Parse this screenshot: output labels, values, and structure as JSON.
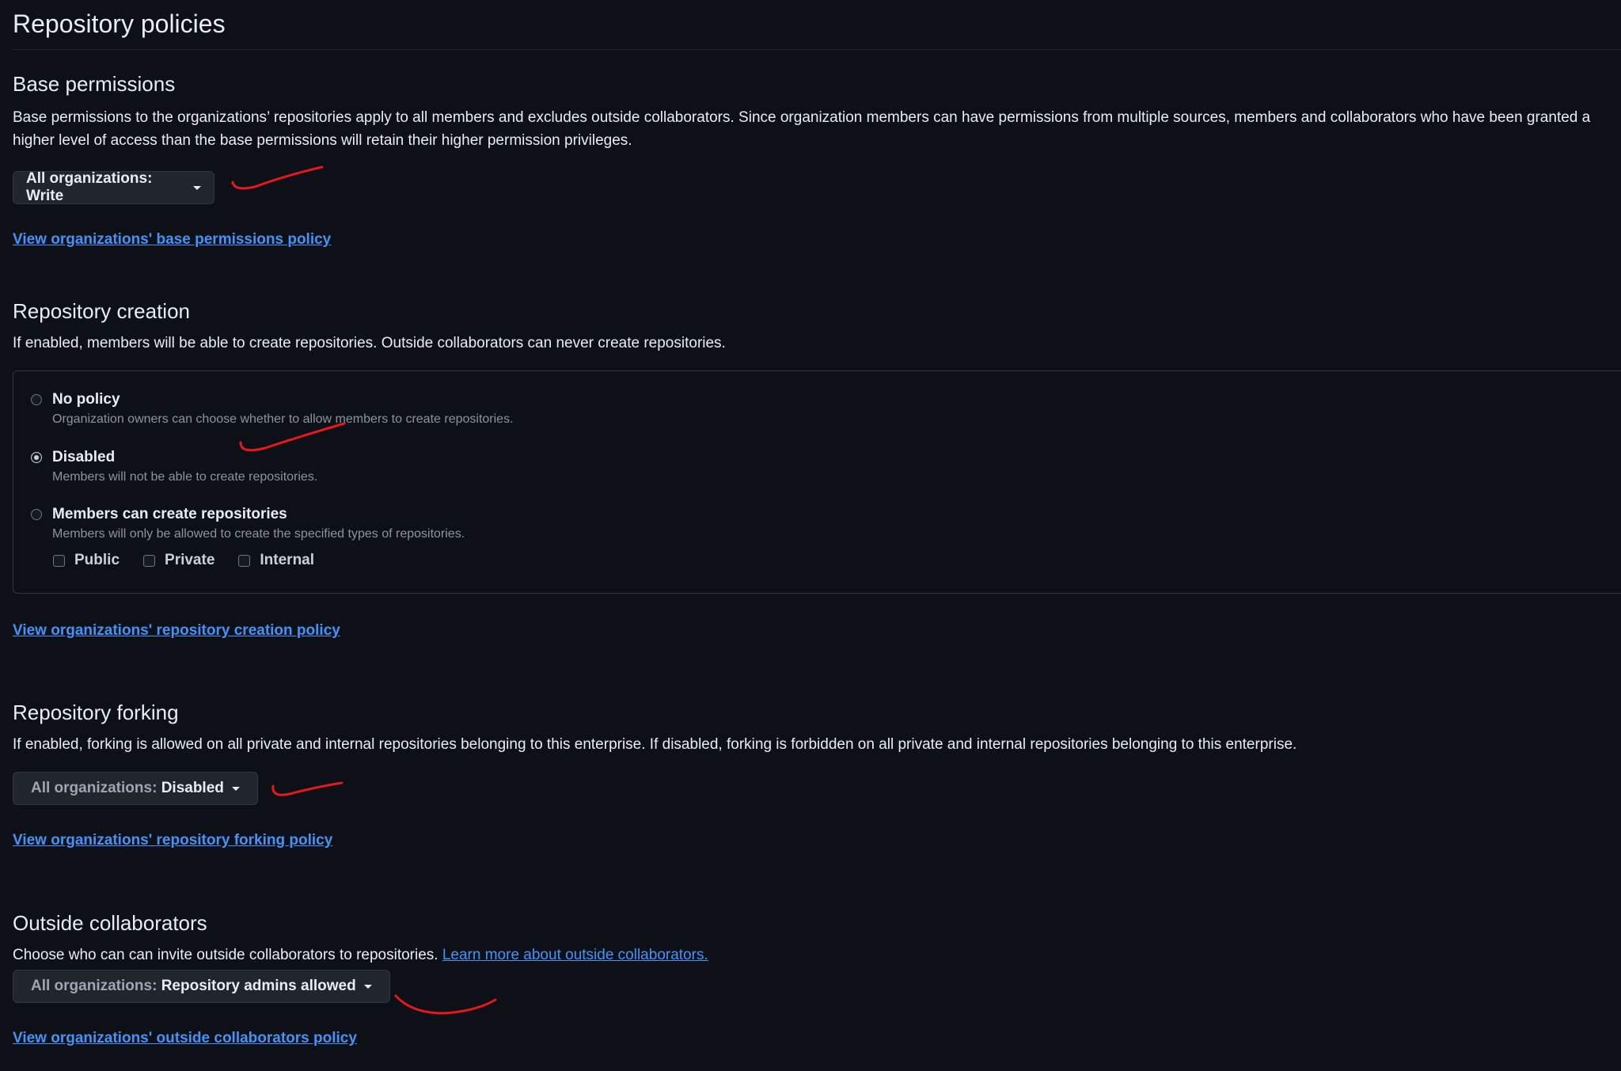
{
  "page": {
    "title": "Repository policies"
  },
  "base_permissions": {
    "heading": "Base permissions",
    "description": "Base permissions to the organizations’ repositories apply to all members and excludes outside collaborators. Since organization members can have permissions from multiple sources, members and collaborators who have been granted a higher level of access than the base permissions will retain their higher permission privileges.",
    "dropdown_label": "All organizations: Write",
    "policy_link": "View organizations' base permissions policy"
  },
  "repository_creation": {
    "heading": "Repository creation",
    "description": "If enabled, members will be able to create repositories. Outside collaborators can never create repositories.",
    "options": [
      {
        "label": "No policy",
        "help": "Organization owners can choose whether to allow members to create repositories.",
        "checked": false
      },
      {
        "label": "Disabled",
        "help": "Members will not be able to create repositories.",
        "checked": true
      },
      {
        "label": "Members can create repositories",
        "help": "Members will only be allowed to create the specified types of repositories.",
        "checked": false
      }
    ],
    "repo_types": [
      "Public",
      "Private",
      "Internal"
    ],
    "policy_link": "View organizations' repository creation policy"
  },
  "repository_forking": {
    "heading": "Repository forking",
    "description": "If enabled, forking is allowed on all private and internal repositories belonging to this enterprise. If disabled, forking is forbidden on all private and internal repositories belonging to this enterprise.",
    "dropdown_prefix": "All organizations:",
    "dropdown_value": "Disabled",
    "policy_link": "View organizations' repository forking policy"
  },
  "outside_collaborators": {
    "heading": "Outside collaborators",
    "description": "Choose who can can invite outside collaborators to repositories.",
    "learn_more": "Learn more about outside collaborators.",
    "dropdown_prefix": "All organizations:",
    "dropdown_value": "Repository admins allowed",
    "policy_link": "View organizations' outside collaborators policy"
  },
  "colors": {
    "background": "#0d1117",
    "text": "#e6edf3",
    "muted_text": "#8b949e",
    "link": "#4493f8",
    "button_bg": "#21262d",
    "border": "#30363d",
    "annotation": "#e5181b"
  }
}
